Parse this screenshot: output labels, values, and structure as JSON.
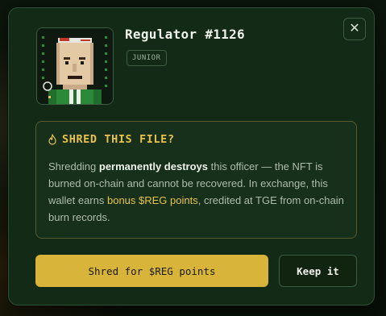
{
  "modal": {
    "close_glyph": "✕",
    "nft": {
      "title": "Regulator #1126",
      "rank_badge": "JUNIOR",
      "avatar_icon": "pixel-officer-avatar"
    },
    "warning": {
      "heading": "SHRED THIS FILE?",
      "heading_icon": "flame-icon",
      "body": {
        "part1": "Shredding ",
        "strong": "permanently destroys",
        "part2": " this officer — the NFT is burned on-chain and cannot be recovered. In exchange, this wallet earns ",
        "accent": "bonus $REG points",
        "part3": ", credited at TGE from on-chain burn records."
      }
    },
    "actions": {
      "shred_label": "Shred for $REG points",
      "keep_label": "Keep it"
    }
  },
  "colors": {
    "modal_bg": "#132a17",
    "accent_gold": "#e8c24a",
    "button_gold": "#d8b43a",
    "border_green": "#3b5e40"
  }
}
